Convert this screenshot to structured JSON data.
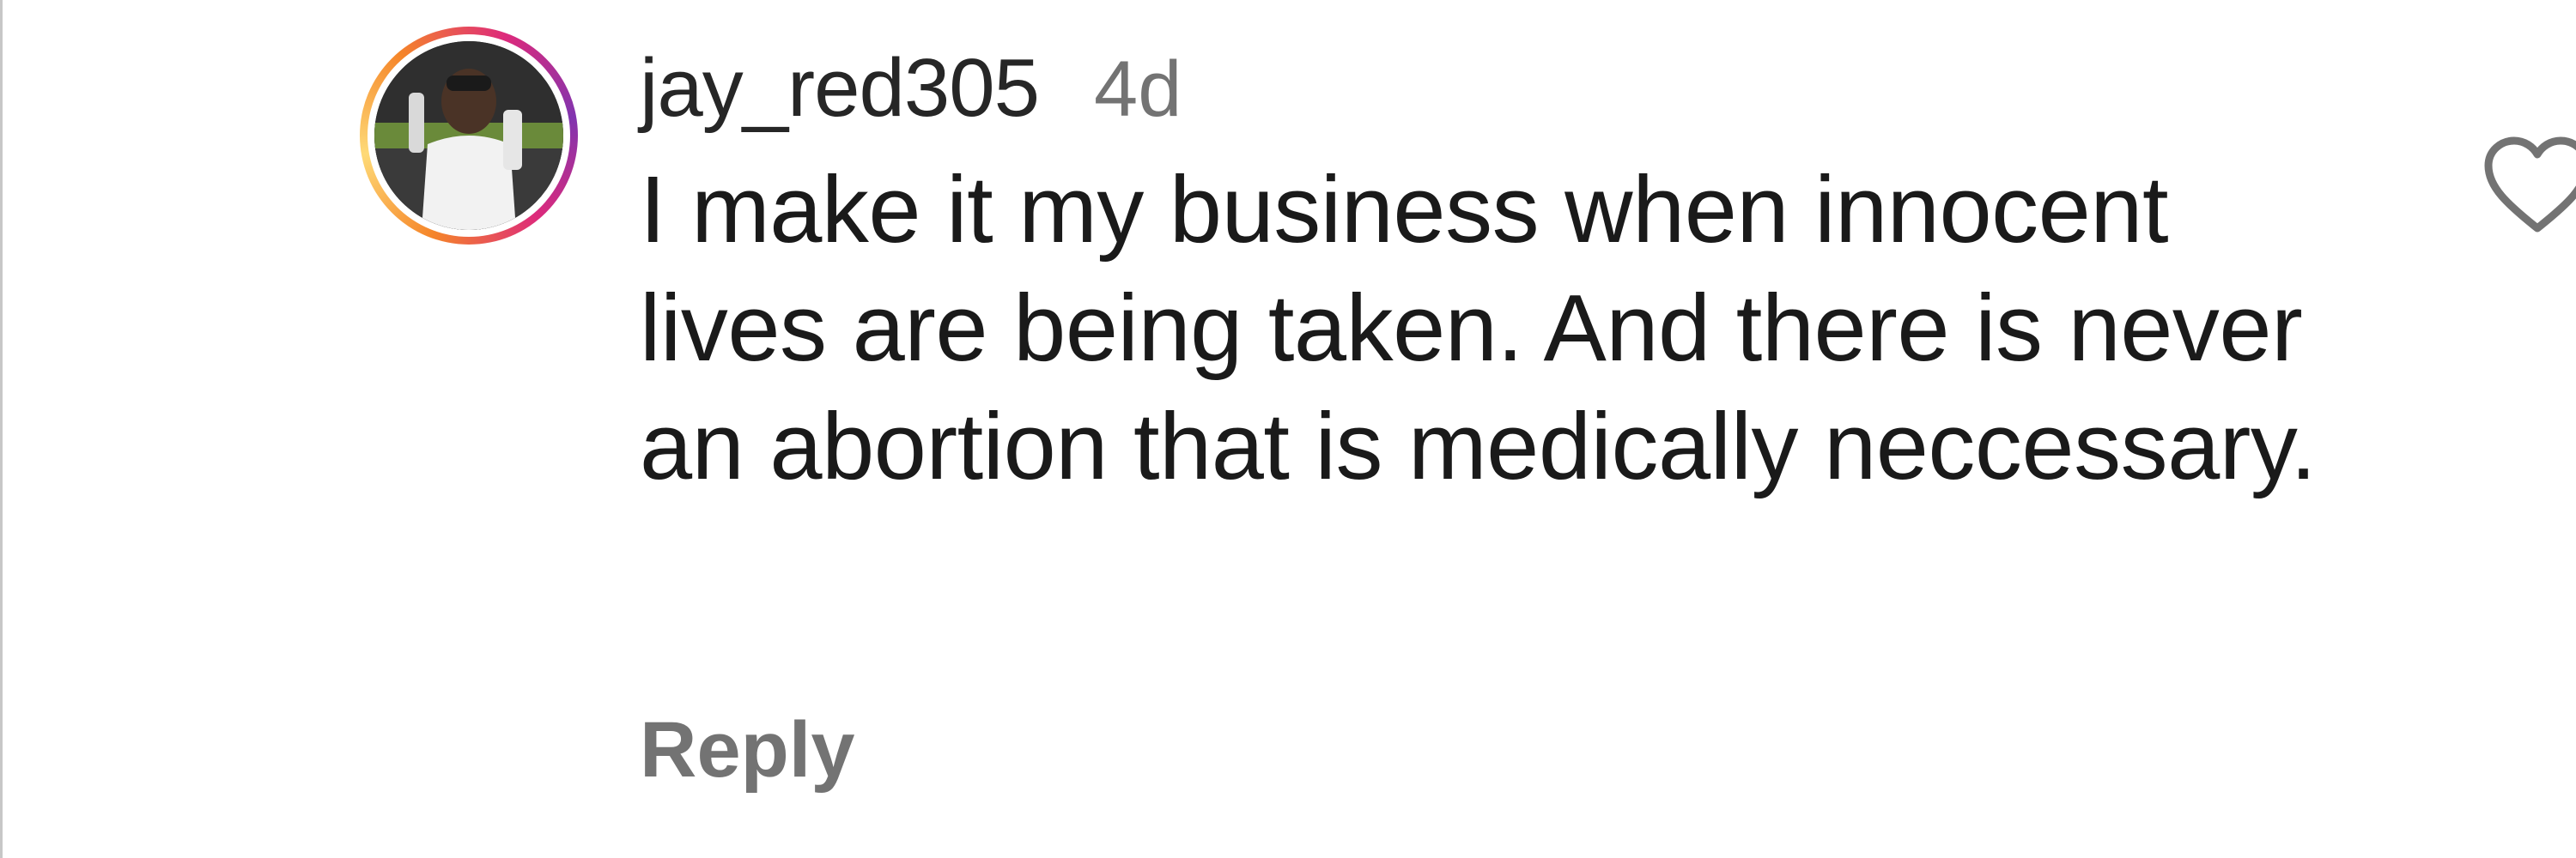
{
  "comment": {
    "username": "jay_red305",
    "timestamp": "4d",
    "text": "I make it my business when innocent lives are being taken. And there is never an abortion that is medically neccessary.",
    "reply_label": "Reply",
    "has_story_ring": true,
    "like_icon": "heart-outline-icon"
  },
  "colors": {
    "username": "#262626",
    "meta": "#737373",
    "body": "#1a1a1a",
    "ring_start": "#f58529",
    "ring_end": "#dd2a7b"
  }
}
